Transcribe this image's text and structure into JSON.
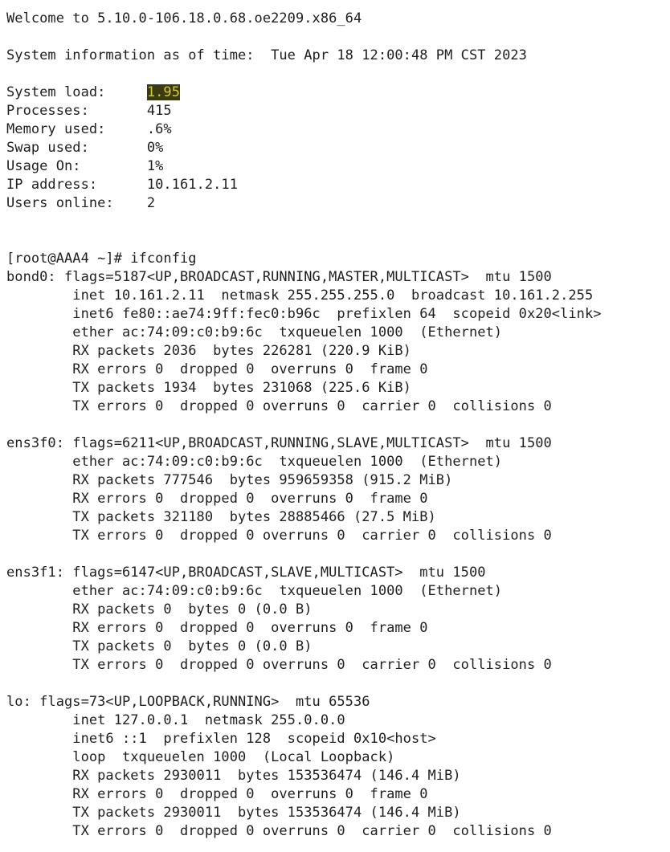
{
  "motd": {
    "welcome": "Welcome to 5.10.0-106.18.0.68.oe2209.x86_64",
    "sysinfo": "System information as of time:  Tue Apr 18 12:00:48 PM CST 2023",
    "stats": [
      {
        "label": "System load:     ",
        "value": "1.95",
        "highlight": true
      },
      {
        "label": "Processes:       ",
        "value": "415"
      },
      {
        "label": "Memory used:     ",
        "value": ".6%"
      },
      {
        "label": "Swap used:       ",
        "value": "0%"
      },
      {
        "label": "Usage On:        ",
        "value": "1%"
      },
      {
        "label": "IP address:      ",
        "value": "10.161.2.11"
      },
      {
        "label": "Users online:    ",
        "value": "2"
      }
    ]
  },
  "command": {
    "prompt": "[root@AAA4 ~]# ",
    "text": "ifconfig"
  },
  "interfaces": [
    {
      "header": "bond0: flags=5187<UP,BROADCAST,RUNNING,MASTER,MULTICAST>  mtu 1500",
      "lines": [
        "        inet 10.161.2.11  netmask 255.255.255.0  broadcast 10.161.2.255",
        "        inet6 fe80::ae74:9ff:fec0:b96c  prefixlen 64  scopeid 0x20<link>",
        "        ether ac:74:09:c0:b9:6c  txqueuelen 1000  (Ethernet)",
        "        RX packets 2036  bytes 226281 (220.9 KiB)",
        "        RX errors 0  dropped 0  overruns 0  frame 0",
        "        TX packets 1934  bytes 231068 (225.6 KiB)",
        "        TX errors 0  dropped 0 overruns 0  carrier 0  collisions 0"
      ]
    },
    {
      "header": "ens3f0: flags=6211<UP,BROADCAST,RUNNING,SLAVE,MULTICAST>  mtu 1500",
      "lines": [
        "        ether ac:74:09:c0:b9:6c  txqueuelen 1000  (Ethernet)",
        "        RX packets 777546  bytes 959659358 (915.2 MiB)",
        "        RX errors 0  dropped 0  overruns 0  frame 0",
        "        TX packets 321180  bytes 28885466 (27.5 MiB)",
        "        TX errors 0  dropped 0 overruns 0  carrier 0  collisions 0"
      ]
    },
    {
      "header": "ens3f1: flags=6147<UP,BROADCAST,SLAVE,MULTICAST>  mtu 1500",
      "lines": [
        "        ether ac:74:09:c0:b9:6c  txqueuelen 1000  (Ethernet)",
        "        RX packets 0  bytes 0 (0.0 B)",
        "        RX errors 0  dropped 0  overruns 0  frame 0",
        "        TX packets 0  bytes 0 (0.0 B)",
        "        TX errors 0  dropped 0 overruns 0  carrier 0  collisions 0"
      ]
    },
    {
      "header": "lo: flags=73<UP,LOOPBACK,RUNNING>  mtu 65536",
      "lines": [
        "        inet 127.0.0.1  netmask 255.0.0.0",
        "        inet6 ::1  prefixlen 128  scopeid 0x10<host>",
        "        loop  txqueuelen 1000  (Local Loopback)",
        "        RX packets 2930011  bytes 153536474 (146.4 MiB)",
        "        RX errors 0  dropped 0  overruns 0  frame 0",
        "        TX packets 2930011  bytes 153536474 (146.4 MiB)",
        "        TX errors 0  dropped 0 overruns 0  carrier 0  collisions 0"
      ]
    }
  ]
}
